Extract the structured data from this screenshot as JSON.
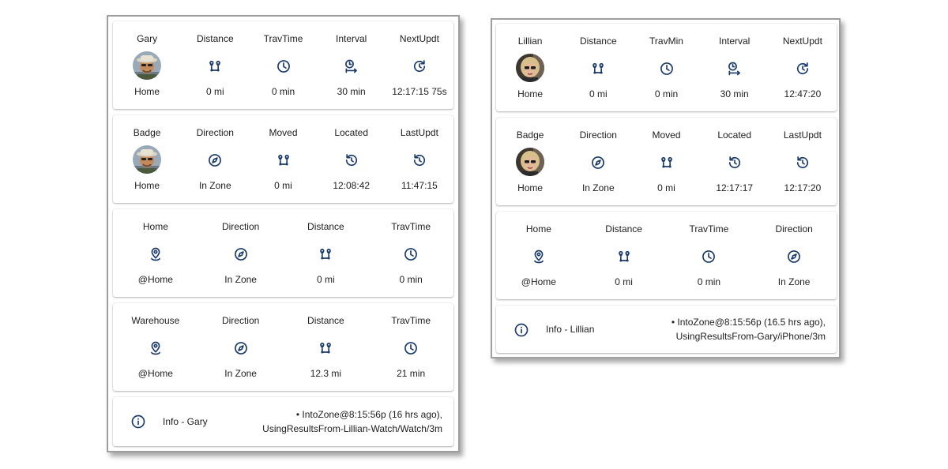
{
  "colors": {
    "icon": "#1a3a6b",
    "text": "#212121",
    "panel_border": "#9e9e9e"
  },
  "gary": {
    "row1": [
      {
        "label": "Gary",
        "icon": "avatar-gary",
        "value": "Home"
      },
      {
        "label": "Distance",
        "icon": "distance-icon",
        "value": "0 mi"
      },
      {
        "label": "TravTime",
        "icon": "clock-icon",
        "value": "0 min"
      },
      {
        "label": "Interval",
        "icon": "interval-icon",
        "value": "30 min"
      },
      {
        "label": "NextUpdt",
        "icon": "refresh-icon",
        "value": "12:17:15 75s"
      }
    ],
    "row2": [
      {
        "label": "Badge",
        "icon": "avatar-gary",
        "value": "Home"
      },
      {
        "label": "Direction",
        "icon": "compass-icon",
        "value": "In Zone"
      },
      {
        "label": "Moved",
        "icon": "distance-icon",
        "value": "0 mi"
      },
      {
        "label": "Located",
        "icon": "history-icon",
        "value": "12:08:42"
      },
      {
        "label": "LastUpdt",
        "icon": "history-icon",
        "value": "11:47:15"
      }
    ],
    "row3": [
      {
        "label": "Home",
        "icon": "location-pin-icon",
        "value": "@Home"
      },
      {
        "label": "Direction",
        "icon": "compass-icon",
        "value": "In Zone"
      },
      {
        "label": "Distance",
        "icon": "distance-icon",
        "value": "0 mi"
      },
      {
        "label": "TravTime",
        "icon": "clock-icon",
        "value": "0 min"
      }
    ],
    "row4": [
      {
        "label": "Warehouse",
        "icon": "location-pin-icon",
        "value": "@Home"
      },
      {
        "label": "Direction",
        "icon": "compass-icon",
        "value": "In Zone"
      },
      {
        "label": "Distance",
        "icon": "distance-icon",
        "value": "12.3 mi"
      },
      {
        "label": "TravTime",
        "icon": "clock-icon",
        "value": "21 min"
      }
    ],
    "info": {
      "title": "Info - Gary",
      "line1": "• IntoZone@8:15:56p (16 hrs ago),",
      "line2": "UsingResultsFrom-Lillian-Watch/Watch/3m"
    }
  },
  "lillian": {
    "row1": [
      {
        "label": "Lillian",
        "icon": "avatar-lillian",
        "value": "Home"
      },
      {
        "label": "Distance",
        "icon": "distance-icon",
        "value": "0 mi"
      },
      {
        "label": "TravMin",
        "icon": "clock-icon",
        "value": "0 min"
      },
      {
        "label": "Interval",
        "icon": "interval-icon",
        "value": "30 min"
      },
      {
        "label": "NextUpdt",
        "icon": "refresh-icon",
        "value": "12:47:20"
      }
    ],
    "row2": [
      {
        "label": "Badge",
        "icon": "avatar-lillian",
        "value": "Home"
      },
      {
        "label": "Direction",
        "icon": "compass-icon",
        "value": "In Zone"
      },
      {
        "label": "Moved",
        "icon": "distance-icon",
        "value": "0 mi"
      },
      {
        "label": "Located",
        "icon": "history-icon",
        "value": "12:17:17"
      },
      {
        "label": "LastUpdt",
        "icon": "history-icon",
        "value": "12:17:20"
      }
    ],
    "row3": [
      {
        "label": "Home",
        "icon": "location-pin-icon",
        "value": "@Home"
      },
      {
        "label": "Distance",
        "icon": "distance-icon",
        "value": "0 mi"
      },
      {
        "label": "TravTime",
        "icon": "clock-icon",
        "value": "0 min"
      },
      {
        "label": "Direction",
        "icon": "compass-icon",
        "value": "In Zone"
      }
    ],
    "info": {
      "title": "Info - Lillian",
      "line1": "• IntoZone@8:15:56p (16.5 hrs ago),",
      "line2": "UsingResultsFrom-Gary/iPhone/3m"
    }
  }
}
